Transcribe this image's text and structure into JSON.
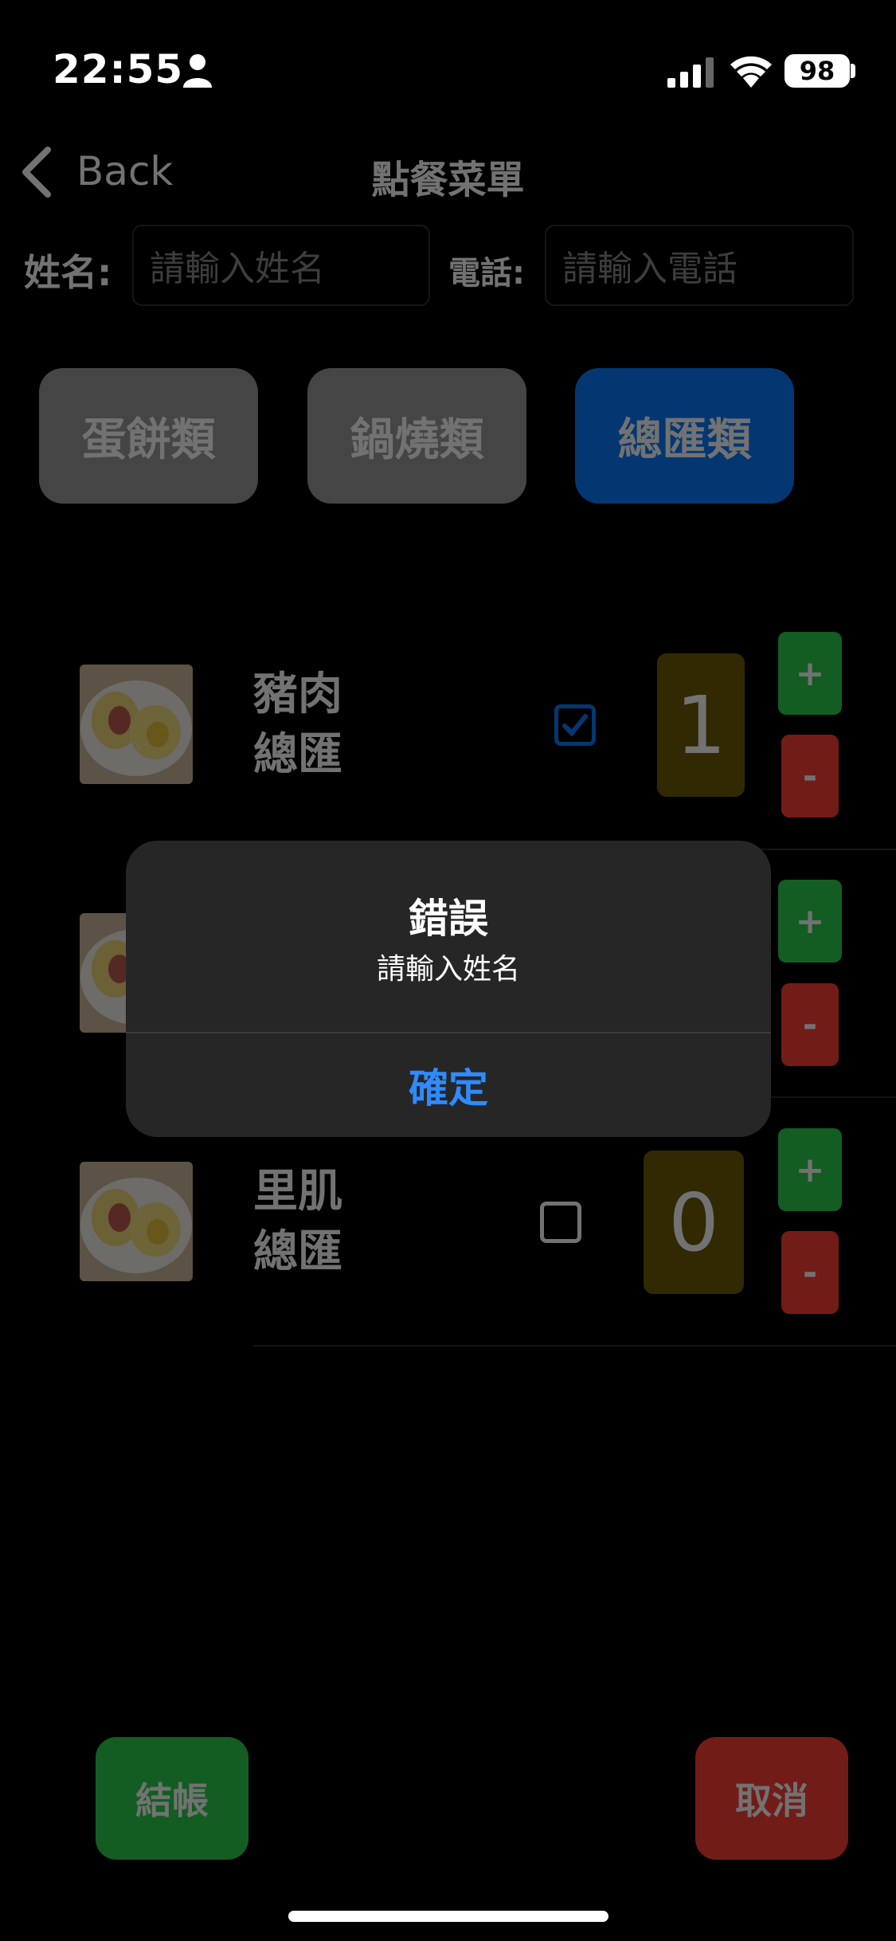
{
  "status_bar": {
    "time": "22:55",
    "battery": "98"
  },
  "nav": {
    "back_label": "Back",
    "title": "點餐菜單"
  },
  "form": {
    "name_label": "姓名:",
    "name_placeholder": "請輸入姓名",
    "phone_label": "電話:",
    "phone_placeholder": "請輸入電話"
  },
  "categories": [
    {
      "label": "蛋餅類",
      "selected": false
    },
    {
      "label": "鍋燒類",
      "selected": false
    },
    {
      "label": "總匯類",
      "selected": true
    }
  ],
  "items": [
    {
      "line1": "豬肉",
      "line2": "總匯",
      "checked": true,
      "qty": "1",
      "plus": "+",
      "minus": "-"
    },
    {
      "line1": "",
      "line2": "",
      "checked": false,
      "qty": "",
      "plus": "+",
      "minus": "-"
    },
    {
      "line1": "里肌",
      "line2": "總匯",
      "checked": false,
      "qty": "0",
      "plus": "+",
      "minus": "-"
    }
  ],
  "buttons": {
    "checkout": "結帳",
    "cancel": "取消"
  },
  "alert": {
    "title": "錯誤",
    "message": "請輸入姓名",
    "ok": "確定"
  },
  "colors": {
    "accent_blue": "#0a7bff",
    "green": "#2bd14c",
    "red": "#ff4036",
    "qty_bg": "#6e5c05"
  }
}
